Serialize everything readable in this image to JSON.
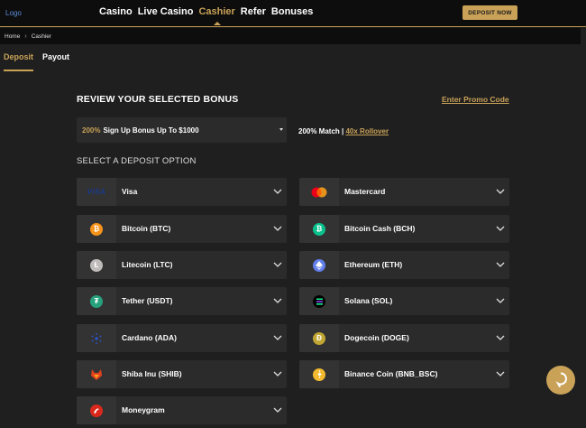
{
  "header": {
    "logo": "Logo",
    "nav": [
      "Casino",
      "Live Casino",
      "Cashier",
      "Refer",
      "Bonuses"
    ],
    "active_nav": "Cashier",
    "deposit_now": "DEPOSIT NOW"
  },
  "breadcrumb": {
    "home": "Home",
    "current": "Cashier"
  },
  "tabs": [
    {
      "label": "Deposit",
      "active": true
    },
    {
      "label": "Payout",
      "active": false
    }
  ],
  "bonus": {
    "title": "REVIEW YOUR SELECTED BONUS",
    "promo_link": "Enter Promo Code",
    "selected_pct": "200%",
    "selected_rest": "Sign Up Bonus Up To $1000",
    "match": "200% Match",
    "separator": " | ",
    "rollover": "40x Rollover"
  },
  "deposit_option_title": "SELECT A DEPOSIT OPTION",
  "payment_methods": [
    {
      "label": "Visa",
      "icon": "visa-icon"
    },
    {
      "label": "Mastercard",
      "icon": "mastercard-icon"
    },
    {
      "label": "Bitcoin (BTC)",
      "icon": "bitcoin-icon"
    },
    {
      "label": "Bitcoin Cash (BCH)",
      "icon": "bitcoin-cash-icon"
    },
    {
      "label": "Litecoin (LTC)",
      "icon": "litecoin-icon"
    },
    {
      "label": "Ethereum (ETH)",
      "icon": "ethereum-icon"
    },
    {
      "label": "Tether (USDT)",
      "icon": "tether-icon"
    },
    {
      "label": "Solana (SOL)",
      "icon": "solana-icon"
    },
    {
      "label": "Cardano (ADA)",
      "icon": "cardano-icon"
    },
    {
      "label": "Dogecoin (DOGE)",
      "icon": "dogecoin-icon"
    },
    {
      "label": "Shiba Inu (SHIB)",
      "icon": "shiba-inu-icon"
    },
    {
      "label": "Binance Coin (BNB_BSC)",
      "icon": "binance-coin-icon"
    },
    {
      "label": "Moneygram",
      "icon": "moneygram-icon"
    }
  ],
  "visa_mark": "VISA",
  "colors": {
    "accent": "#c9a258",
    "background": "#1f1f1f",
    "card": "#2b2b2b"
  }
}
